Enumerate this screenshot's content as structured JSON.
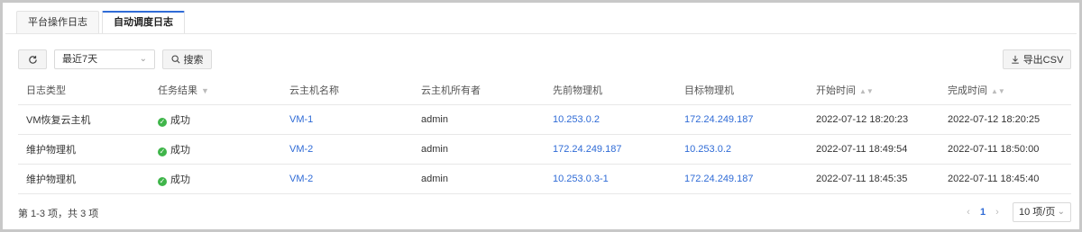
{
  "tabs": [
    {
      "label": "平台操作日志",
      "active": false
    },
    {
      "label": "自动调度日志",
      "active": true
    }
  ],
  "toolbar": {
    "range_value": "最近7天",
    "search_label": "搜索",
    "export_label": "导出CSV"
  },
  "table": {
    "headers": [
      "日志类型",
      "任务结果",
      "云主机名称",
      "云主机所有者",
      "先前物理机",
      "目标物理机",
      "开始时间",
      "完成时间"
    ],
    "rows": [
      {
        "type": "VM恢复云主机",
        "result": "成功",
        "vm": "VM-1",
        "owner": "admin",
        "prev": "10.253.0.2",
        "target": "172.24.249.187",
        "start": "2022-07-12 18:20:23",
        "end": "2022-07-12 18:20:25"
      },
      {
        "type": "维护物理机",
        "result": "成功",
        "vm": "VM-2",
        "owner": "admin",
        "prev": "172.24.249.187",
        "target": "10.253.0.2",
        "start": "2022-07-11 18:49:54",
        "end": "2022-07-11 18:50:00"
      },
      {
        "type": "维护物理机",
        "result": "成功",
        "vm": "VM-2",
        "owner": "admin",
        "prev": "10.253.0.3-1",
        "target": "172.24.249.187",
        "start": "2022-07-11 18:45:35",
        "end": "2022-07-11 18:45:40"
      }
    ]
  },
  "footer": {
    "summary": "第 1-3 项，共 3 项",
    "current_page": "1",
    "page_size": "10 项/页"
  },
  "colors": {
    "accent": "#2f6bd6",
    "success": "#3fb54a"
  }
}
